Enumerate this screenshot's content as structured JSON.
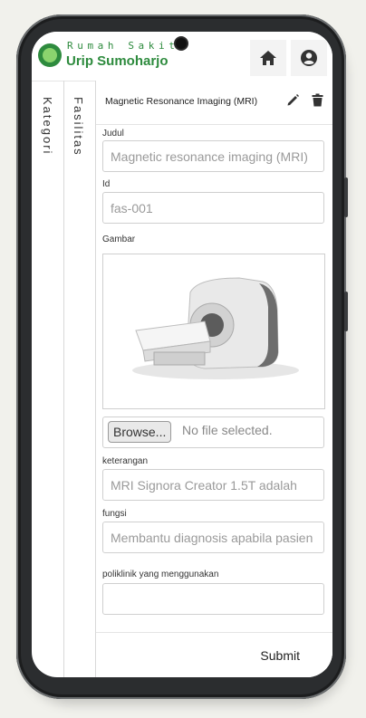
{
  "header": {
    "brand_line1": "Rumah Sakit",
    "brand_line2": "Urip Sumoharjo",
    "accent_color": "#2e8b3e",
    "home_icon": "home-icon",
    "account_icon": "account-icon"
  },
  "tabs": [
    {
      "label": "Kategori"
    },
    {
      "label": "Fasilitas"
    }
  ],
  "item": {
    "title": "Magnetic Resonance Imaging (MRI)",
    "edit_icon": "pencil-icon",
    "delete_icon": "trash-icon"
  },
  "form": {
    "judul_label": "Judul",
    "judul_value": "Magnetic resonance imaging (MRI)",
    "id_label": "Id",
    "id_value": "fas-001",
    "gambar_label": "Gambar",
    "browse_label": "Browse...",
    "no_file_text": "No file selected.",
    "keterangan_label": "keterangan",
    "keterangan_value": "MRI Signora Creator 1.5T adalah",
    "fungsi_label": "fungsi",
    "fungsi_value": "Membantu diagnosis apabila pasien",
    "poliklinik_label": "poliklinik yang menggunakan"
  },
  "footer": {
    "submit_label": "Submit"
  }
}
